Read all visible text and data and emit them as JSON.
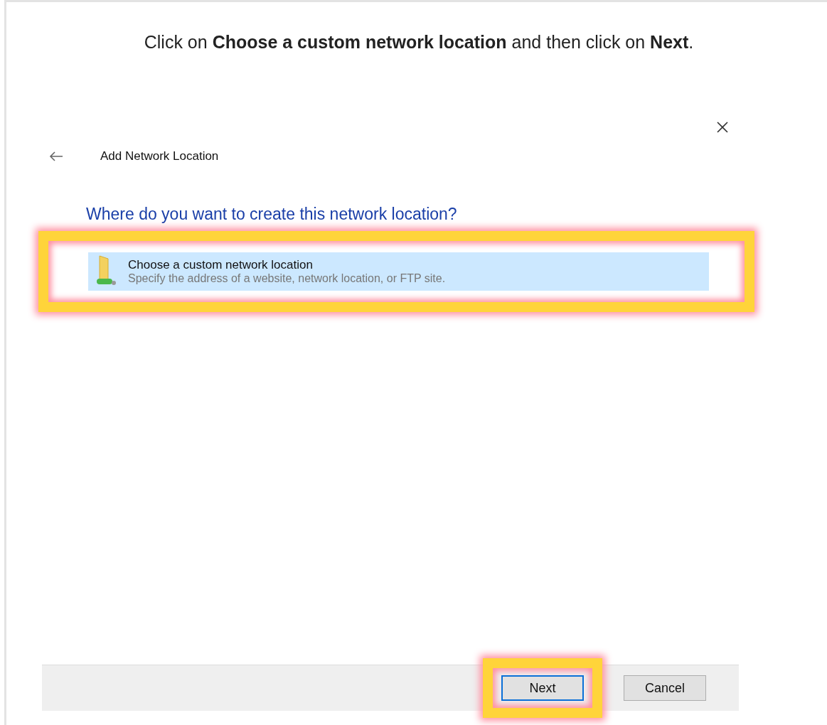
{
  "instruction": "Click on **Choose a custom network location** and then click on **Next**.",
  "dialog": {
    "title": "Add Network Location",
    "heading": "Where do you want to create this network location?",
    "options": [
      {
        "title": "Choose a custom network location",
        "description": "Specify the address of a website, network location, or FTP site.",
        "selected": true,
        "highlighted": true
      }
    ],
    "buttons": [
      {
        "label": "Next",
        "default": true,
        "highlighted": true
      },
      {
        "label": "Cancel",
        "default": false,
        "highlighted": false
      }
    ]
  }
}
